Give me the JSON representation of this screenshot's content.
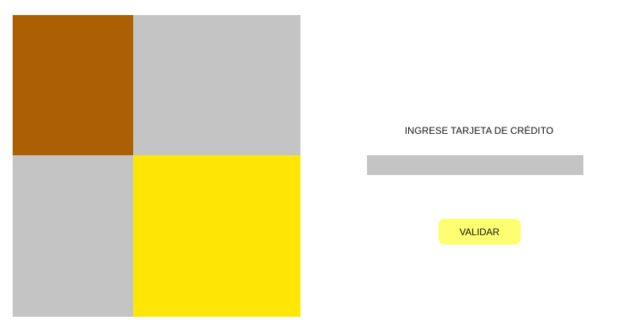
{
  "color_grid": {
    "tiles": [
      {
        "position": "top-left",
        "color": "#ad5f04"
      },
      {
        "position": "top-right",
        "color": "#c4c4c4"
      },
      {
        "position": "bottom-left",
        "color": "#c4c4c4"
      },
      {
        "position": "bottom-right",
        "color": "#ffe604"
      }
    ]
  },
  "form": {
    "prompt": "INGRESE TARJETA DE CRÉDITO",
    "card_input": {
      "value": "",
      "placeholder": "",
      "background": "#c4c4c4"
    },
    "validate_button": {
      "label": "VALIDAR",
      "background": "#fdff70"
    }
  }
}
